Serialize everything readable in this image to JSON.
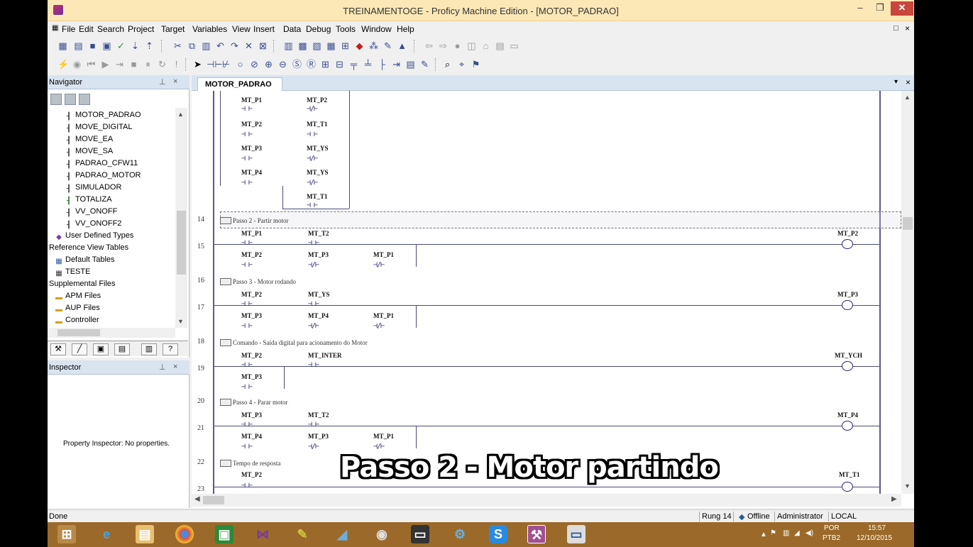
{
  "window": {
    "title": "TREINAMENTOGE - Proficy Machine Edition - [MOTOR_PADRAO]",
    "minimize": "–",
    "maximize": "❐",
    "close": "✕"
  },
  "menu": {
    "items": [
      "File",
      "Edit",
      "Search",
      "Project",
      "Target",
      "Variables",
      "View",
      "Insert",
      "Data",
      "Debug",
      "Tools",
      "Window",
      "Help"
    ],
    "restore": "□",
    "close": "×"
  },
  "navigator": {
    "title": "Navigator",
    "pin": "⊥",
    "close": "×",
    "tree": [
      "MOTOR_PADRAO",
      "MOVE_DIGITAL",
      "MOVE_EA",
      "MOVE_SA",
      "PADRAO_CFW11",
      "PADRAO_MOTOR",
      "SIMULADOR",
      "TOTALIZA",
      "VV_ONOFF",
      "VV_ONOFF2",
      "User Defined Types",
      "Reference View Tables",
      "Default Tables",
      "TESTE",
      "Supplemental Files",
      "APM Files",
      "AUP Files",
      "Controller"
    ]
  },
  "inspector": {
    "title": "Inspector",
    "empty_text": "Property Inspector: No properties."
  },
  "editor": {
    "tab": "MOTOR_PADRAO",
    "menu_glyph": "▾",
    "close_glyph": "×"
  },
  "ladder": {
    "rung_numbers": [
      "14",
      "15",
      "16",
      "17",
      "18",
      "19",
      "20",
      "21",
      "22",
      "23"
    ],
    "comments": [
      "Passo 2 - Partir motor",
      "Passo 3 - Motor rodando",
      "Comando - Saída digital para acionamento do Motor",
      "Passo 4 - Parar motor",
      "Tempo de resposta"
    ],
    "tags": {
      "top": [
        "MT_P1",
        "MT_P2",
        "MT_P2",
        "MT_T1",
        "MT_P3",
        "MT_YS",
        "MT_P4",
        "MT_YS",
        "MT_T1"
      ],
      "r15": [
        "MT_P1",
        "MT_T2",
        "MT_P2",
        "MT_P3",
        "MT_P1",
        "MT_P2"
      ],
      "r17": [
        "MT_P2",
        "MT_YS",
        "MT_P3",
        "MT_P4",
        "MT_P1",
        "MT_P3"
      ],
      "r19": [
        "MT_P2",
        "MT_INTER",
        "MT_P3",
        "MT_YCH"
      ],
      "r21": [
        "MT_P3",
        "MT_T2",
        "MT_P4",
        "MT_P3",
        "MT_P1",
        "MT_P4"
      ],
      "r23": [
        "MT_P2",
        "MT_T1"
      ]
    }
  },
  "status": {
    "left": "Done",
    "rung": "Rung 14",
    "mode": "Offline",
    "user": "Administrator",
    "location": "LOCAL"
  },
  "taskbar": {
    "lang_top": "POR",
    "lang_bottom": "PTB2",
    "time": "15:57",
    "date": "12/10/2015"
  },
  "caption": "Passo 2 - Motor partindo"
}
